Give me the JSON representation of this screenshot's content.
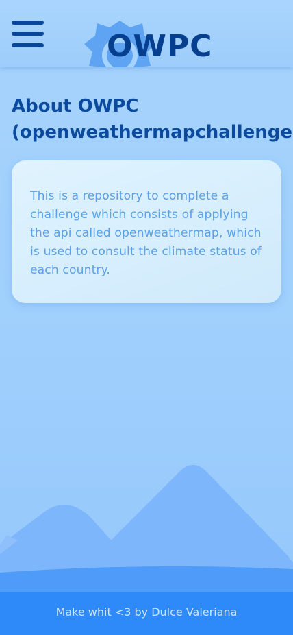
{
  "header": {
    "logo_text": "OWPC",
    "menu_icon": "hamburger-menu-icon",
    "logo_icon": "sun-icon"
  },
  "main": {
    "title": "About OWPC (openweathermapchallenge)",
    "description": "This is a repository to complete a challenge which consists of applying the api called openweathermap, which is used to consult the climate status of each country."
  },
  "footer": {
    "credit": "Make whit <3 by Dulce Valeriana"
  },
  "colors": {
    "primary": "#08479a",
    "footer_bg": "#2f8af9",
    "card_text": "#5aa0ec",
    "background": "#a6d3fd"
  }
}
